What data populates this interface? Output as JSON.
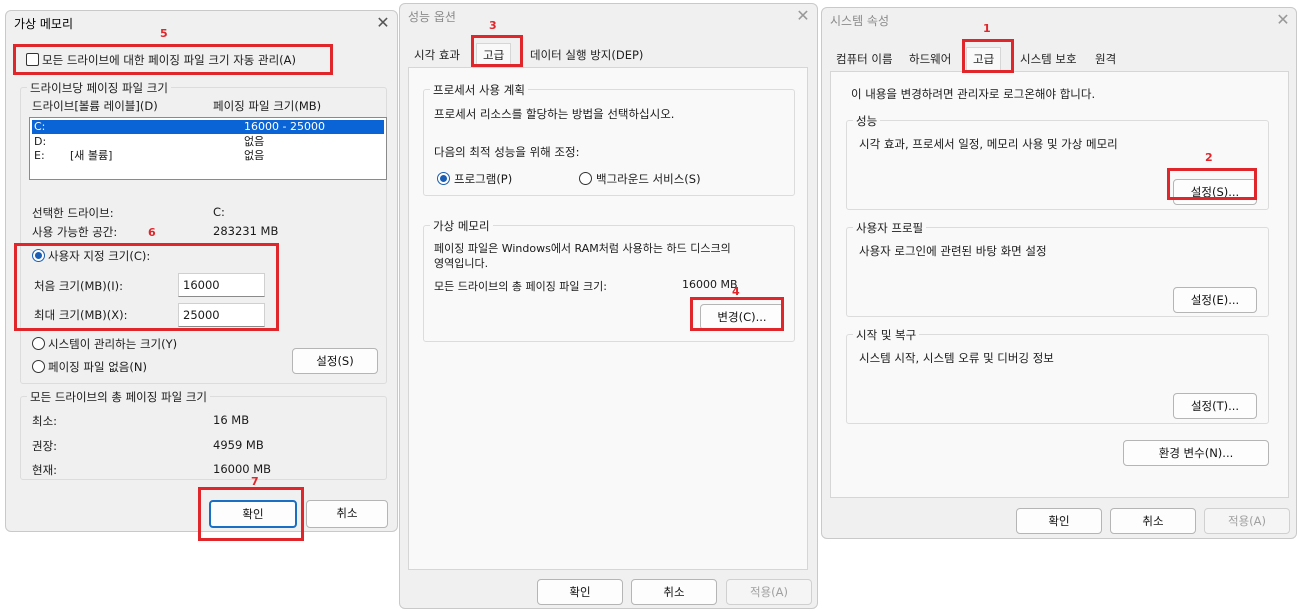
{
  "vm_dialog": {
    "title": "가상 메모리",
    "auto_manage_label": "모든 드라이브에 대한 페이징 파일 크기 자동 관리(A)",
    "per_drive_group": "드라이브당 페이징 파일 크기",
    "col_drive": "드라이브[볼륨 레이블](D)",
    "col_size": "페이징 파일 크기(MB)",
    "drives": [
      {
        "drive": "C:",
        "label": "",
        "size": "16000 - 25000"
      },
      {
        "drive": "D:",
        "label": "",
        "size": "없음"
      },
      {
        "drive": "E:",
        "label": "[새 볼륨]",
        "size": "없음"
      }
    ],
    "selected_drive_label": "선택한 드라이브:",
    "selected_drive_value": "C:",
    "free_space_label": "사용 가능한 공간:",
    "free_space_value": "283231 MB",
    "custom_size_label": "사용자 지정 크기(C):",
    "initial_size_label": "처음 크기(MB)(I):",
    "initial_size_value": "16000",
    "max_size_label": "최대 크기(MB)(X):",
    "max_size_value": "25000",
    "system_managed_label": "시스템이 관리하는 크기(Y)",
    "no_paging_label": "페이징 파일 없음(N)",
    "set_button": "설정(S)",
    "total_group": "모든 드라이브의 총 페이징 파일 크기",
    "min_label": "최소:",
    "min_value": "16 MB",
    "recommended_label": "권장:",
    "recommended_value": "4959 MB",
    "current_label": "현재:",
    "current_value": "16000 MB",
    "ok_button": "확인",
    "cancel_button": "취소"
  },
  "perf_dialog": {
    "title": "성능 옵션",
    "tabs": [
      "시각 효과",
      "고급",
      "데이터 실행 방지(DEP)"
    ],
    "processor_group": "프로세서 사용 계획",
    "processor_desc": "프로세서 리소스를 할당하는 방법을 선택하십시오.",
    "adjust_label": "다음의 최적 성능을 위해 조정:",
    "programs_label": "프로그램(P)",
    "background_label": "백그라운드 서비스(S)",
    "vm_group": "가상 메모리",
    "vm_desc_line1": "페이징 파일은 Windows에서 RAM처럼 사용하는 하드 디스크의",
    "vm_desc_line2": "영역입니다.",
    "vm_total_label": "모든 드라이브의 총 페이징 파일 크기:",
    "vm_total_value": "16000 MB",
    "change_button": "변경(C)...",
    "ok_button": "확인",
    "cancel_button": "취소",
    "apply_button": "적용(A)"
  },
  "sys_dialog": {
    "title": "시스템 속성",
    "tabs": [
      "컴퓨터 이름",
      "하드웨어",
      "고급",
      "시스템 보호",
      "원격"
    ],
    "admin_note": "이 내용을 변경하려면 관리자로 로그온해야 합니다.",
    "perf_group": "성능",
    "perf_desc": "시각 효과, 프로세서 일정, 메모리 사용 및 가상 메모리",
    "perf_settings_button": "설정(S)...",
    "profile_group": "사용자 프로필",
    "profile_desc": "사용자 로그인에 관련된 바탕 화면 설정",
    "profile_settings_button": "설정(E)...",
    "startup_group": "시작 및 복구",
    "startup_desc": "시스템 시작, 시스템 오류 및 디버깅 정보",
    "startup_settings_button": "설정(T)...",
    "env_button": "환경 변수(N)...",
    "ok_button": "확인",
    "cancel_button": "취소",
    "apply_button": "적용(A)"
  },
  "annotations": [
    "1",
    "2",
    "3",
    "4",
    "5",
    "6",
    "7"
  ],
  "colors": {
    "highlight_red": "#e0262a",
    "selection_blue": "#0a64d6"
  }
}
